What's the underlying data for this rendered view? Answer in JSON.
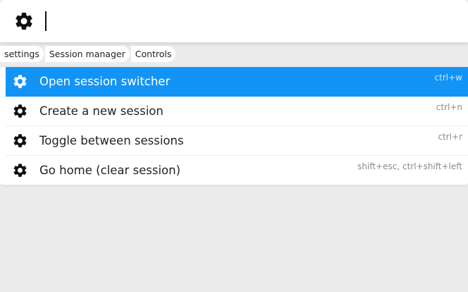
{
  "search": {
    "icon": "gear-icon",
    "value": ""
  },
  "breadcrumbs": [
    "settings",
    "Session manager",
    "Controls"
  ],
  "commands": [
    {
      "label": "Open session switcher",
      "shortcut": "ctrl+w",
      "icon": "gear-icon",
      "selected": true
    },
    {
      "label": "Create a new session",
      "shortcut": "ctrl+n",
      "icon": "gear-icon",
      "selected": false
    },
    {
      "label": "Toggle between sessions",
      "shortcut": "ctrl+r",
      "icon": "gear-icon",
      "selected": false
    },
    {
      "label": "Go home (clear session)",
      "shortcut": "shift+esc, ctrl+shift+left",
      "icon": "gear-icon",
      "selected": false
    }
  ],
  "colors": {
    "accent": "#1294f6",
    "background": "#ebebeb"
  }
}
